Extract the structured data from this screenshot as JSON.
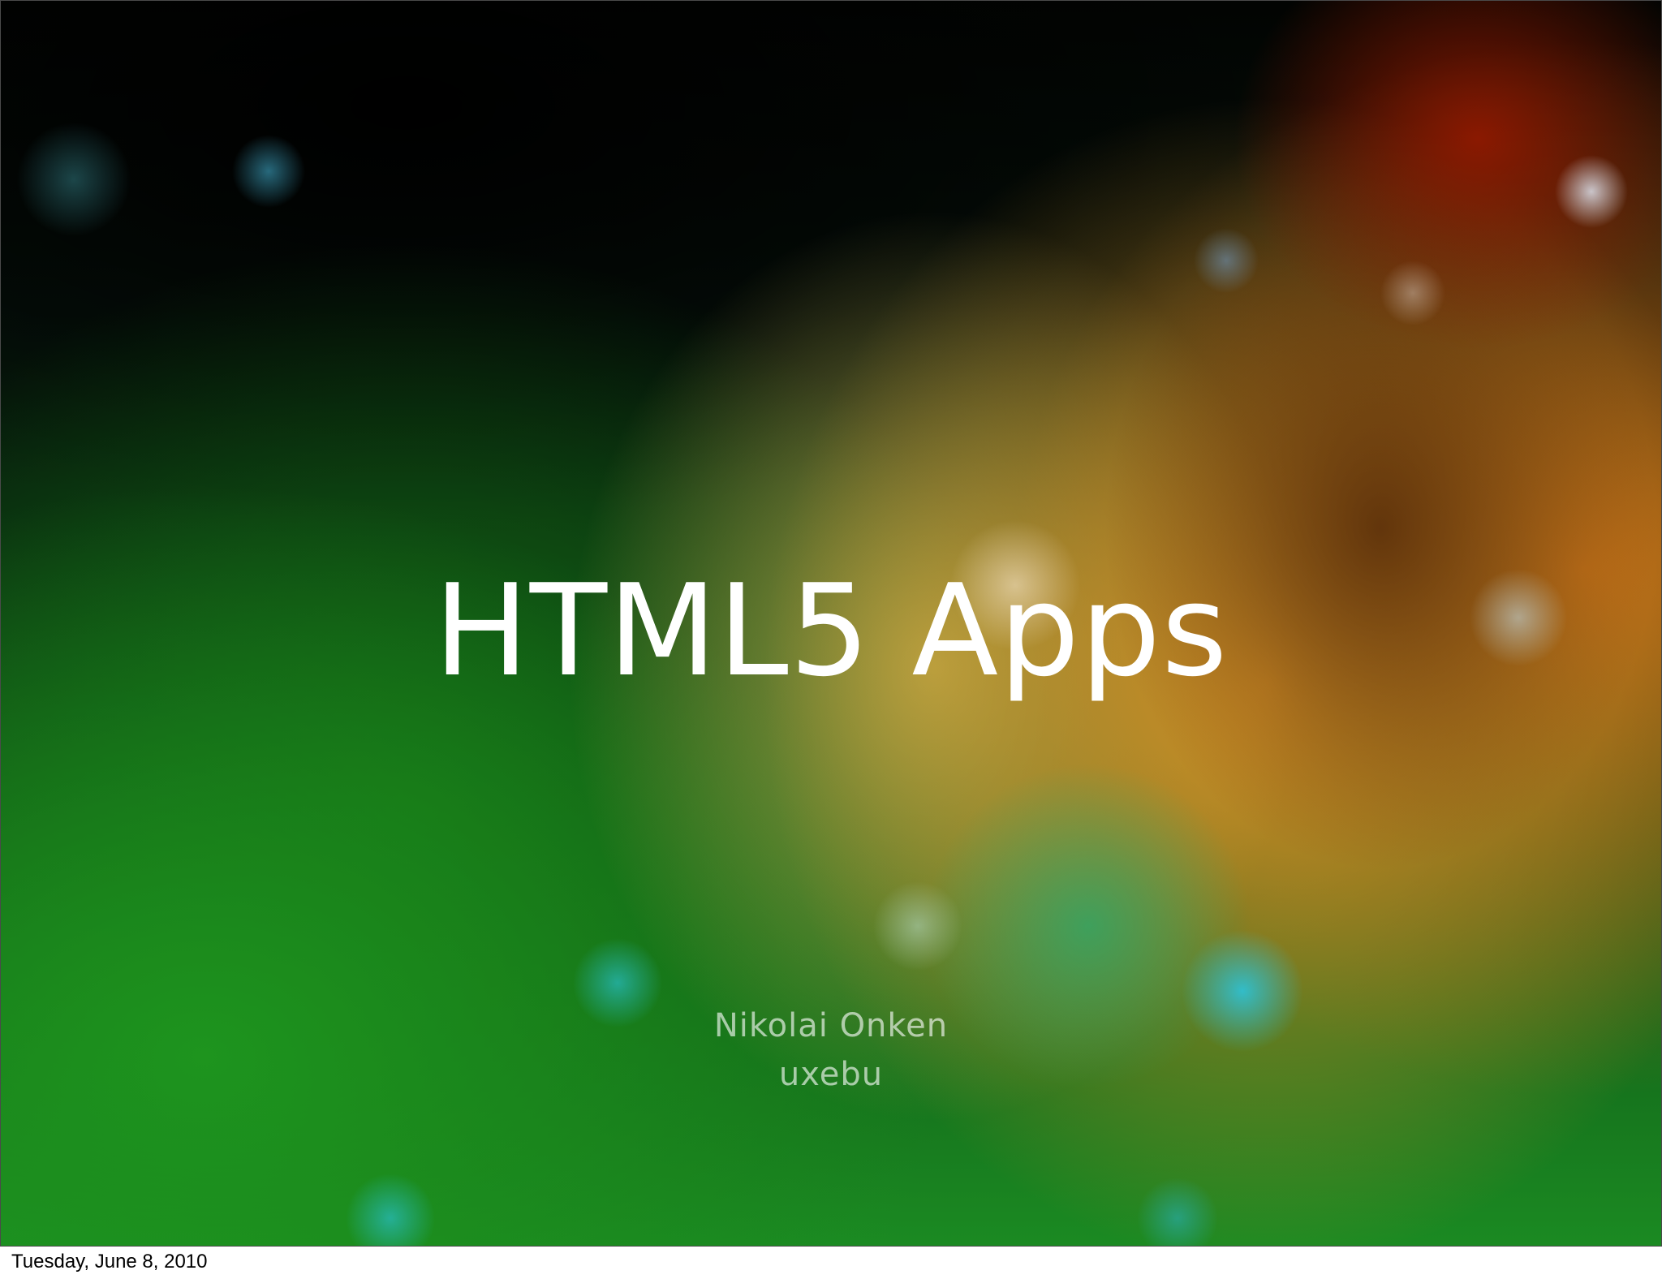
{
  "slide": {
    "title": "HTML5 Apps",
    "author": "Nikolai Onken",
    "organization": "uxebu"
  },
  "footer": {
    "date": "Tuesday, June 8, 2010"
  }
}
